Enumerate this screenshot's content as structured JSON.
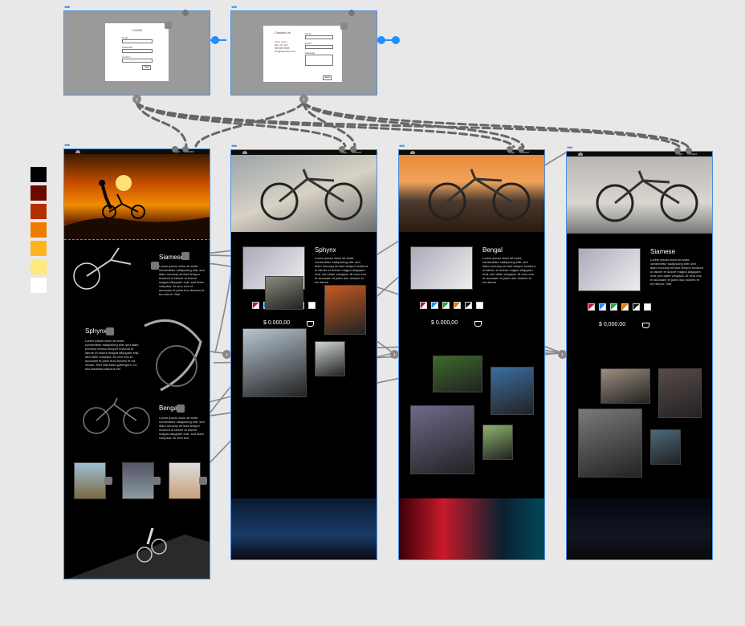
{
  "overlays": [
    {
      "title": "LOGIN",
      "fields": [
        "Email",
        "Password",
        "Confirm"
      ],
      "button": "Login"
    },
    {
      "title": "Contact Us",
      "contact_lines": [
        "Shop Hours",
        "Mon–Fri 9-6",
        "555-555-5555",
        "info@bikeshop.com"
      ],
      "fields": [
        "Name",
        "Email",
        "Message"
      ],
      "button": "Send"
    }
  ],
  "nav": {
    "login": "Login",
    "contact": "Contact"
  },
  "colors": [
    "#000000",
    "#6b0b00",
    "#b33000",
    "#f07a00",
    "#ffb41e",
    "#ffe97a",
    "#ffffff"
  ],
  "home": {
    "items": [
      {
        "name": "Siamese",
        "text": "Lorem ipsum dolor sit amet, consectetur sadipscing elitr, sed diam nonumy eirmod tempor invidunt ut labore et dolore magna aliquyam erat, sed diam voluptua. At vero eos et accusam et justo duo dolores et ea rebum. Stet"
      },
      {
        "name": "Sphynx",
        "text": "Lorem ipsum dolor sit amet, consectetur sadipscing elitr, sed diam nonumy eirmod tempor invidunt ut labore et dolore magna aliquyam erat, sed diam voluptua. At vero eos et accusam et justo duo dolores et ea rebum. Stet clita kasd gubergren, no sea takimata sanctus est"
      },
      {
        "name": "Bengal",
        "text": "Lorem ipsum dolor sit amet, consectetur sadipscing elitr, sed diam nonumy eirmod tempor invidunt ut labore et dolore magna aliquyam erat, sed diam voluptua. At vero eos"
      }
    ]
  },
  "products": [
    {
      "name": "Sphynx",
      "text": "Lorem ipsum dolor sit amet, consectetur sadipscing elitr, sed diam nonumy eirmod tempor invidunt ut labore et dolore magna aliquyam erat, sed diam voluptua. At vero eos et accusam et justo duo dolores et ea rebum.",
      "price": "$ 0.000,00"
    },
    {
      "name": "Bengal",
      "text": "Lorem ipsum dolor sit amet, consectetur sadipscing elitr, sed diam nonumy eirmod tempor invidunt ut labore et dolore magna aliquyam erat, sed diam voluptua. At vero eos et accusam et justo duo dolores et ea rebum.",
      "price": "$ 0.000,00"
    },
    {
      "name": "Siamese",
      "text": "Lorem ipsum dolor sit amet, consectetur sadipscing elitr, sed diam nonumy eirmod tempor invidunt ut labore et dolore magna aliquyam erat, sed diam voluptua. At vero eos et accusam et justo duo dolores et ea rebum. Stet",
      "price": "$ 0,000.00"
    }
  ],
  "chip_colors": [
    "#c8102e",
    "#1e90ff",
    "#22aa44",
    "#f07a00",
    "#111111",
    "#ffffff"
  ],
  "connector_arrow": "›"
}
